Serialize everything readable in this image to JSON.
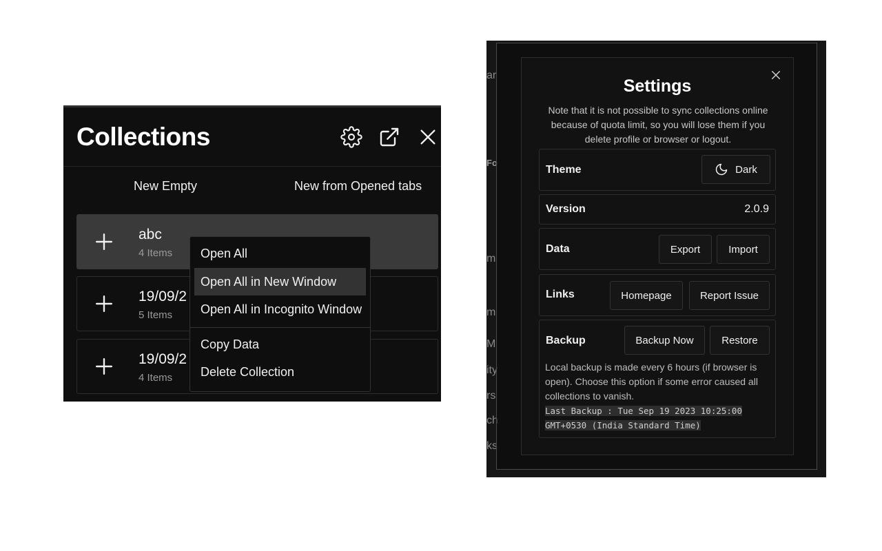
{
  "collections": {
    "title": "Collections",
    "actions": {
      "new_empty": "New Empty",
      "new_from_tabs": "New from Opened tabs"
    },
    "items": [
      {
        "name": "abc",
        "count": "4 Items"
      },
      {
        "name": "19/09/2",
        "count": "5 Items"
      },
      {
        "name": "19/09/2",
        "count": "4 Items"
      }
    ],
    "context_menu": {
      "items": [
        "Open All",
        "Open All in New Window",
        "Open All in Incognito Window",
        "Copy Data",
        "Delete Collection"
      ],
      "highlighted": "Open All in New Window"
    },
    "icons": [
      "gear-icon",
      "external-link-icon",
      "close-icon",
      "plus-icon"
    ]
  },
  "background_fragments": [
    "ar",
    "Fo",
    "m",
    "m",
    "M",
    "ity",
    "rs",
    "ch",
    "ks"
  ],
  "settings": {
    "title": "Settings",
    "note": "Note that it is not possible to sync collections online because of quota limit, so you will lose them if you delete profile or browser or logout.",
    "theme": {
      "label": "Theme",
      "button": "Dark"
    },
    "version": {
      "label": "Version",
      "value": "2.0.9"
    },
    "data": {
      "label": "Data",
      "export": "Export",
      "import": "Import"
    },
    "links": {
      "label": "Links",
      "homepage": "Homepage",
      "report": "Report Issue"
    },
    "backup": {
      "label": "Backup",
      "backup_now": "Backup Now",
      "restore": "Restore",
      "description": "Local backup is made every 6 hours (if browser is open). Choose this option if some error caused all collections to vanish.",
      "last_backup": "Last Backup : Tue Sep 19 2023 10:25:00 GMT+0530 (India Standard Time)"
    }
  },
  "colors": {
    "panel_bg": "#0f0f0f",
    "active_card": "#3a3a3a",
    "menu_hover": "#333333",
    "text": "#f0f0f0"
  }
}
